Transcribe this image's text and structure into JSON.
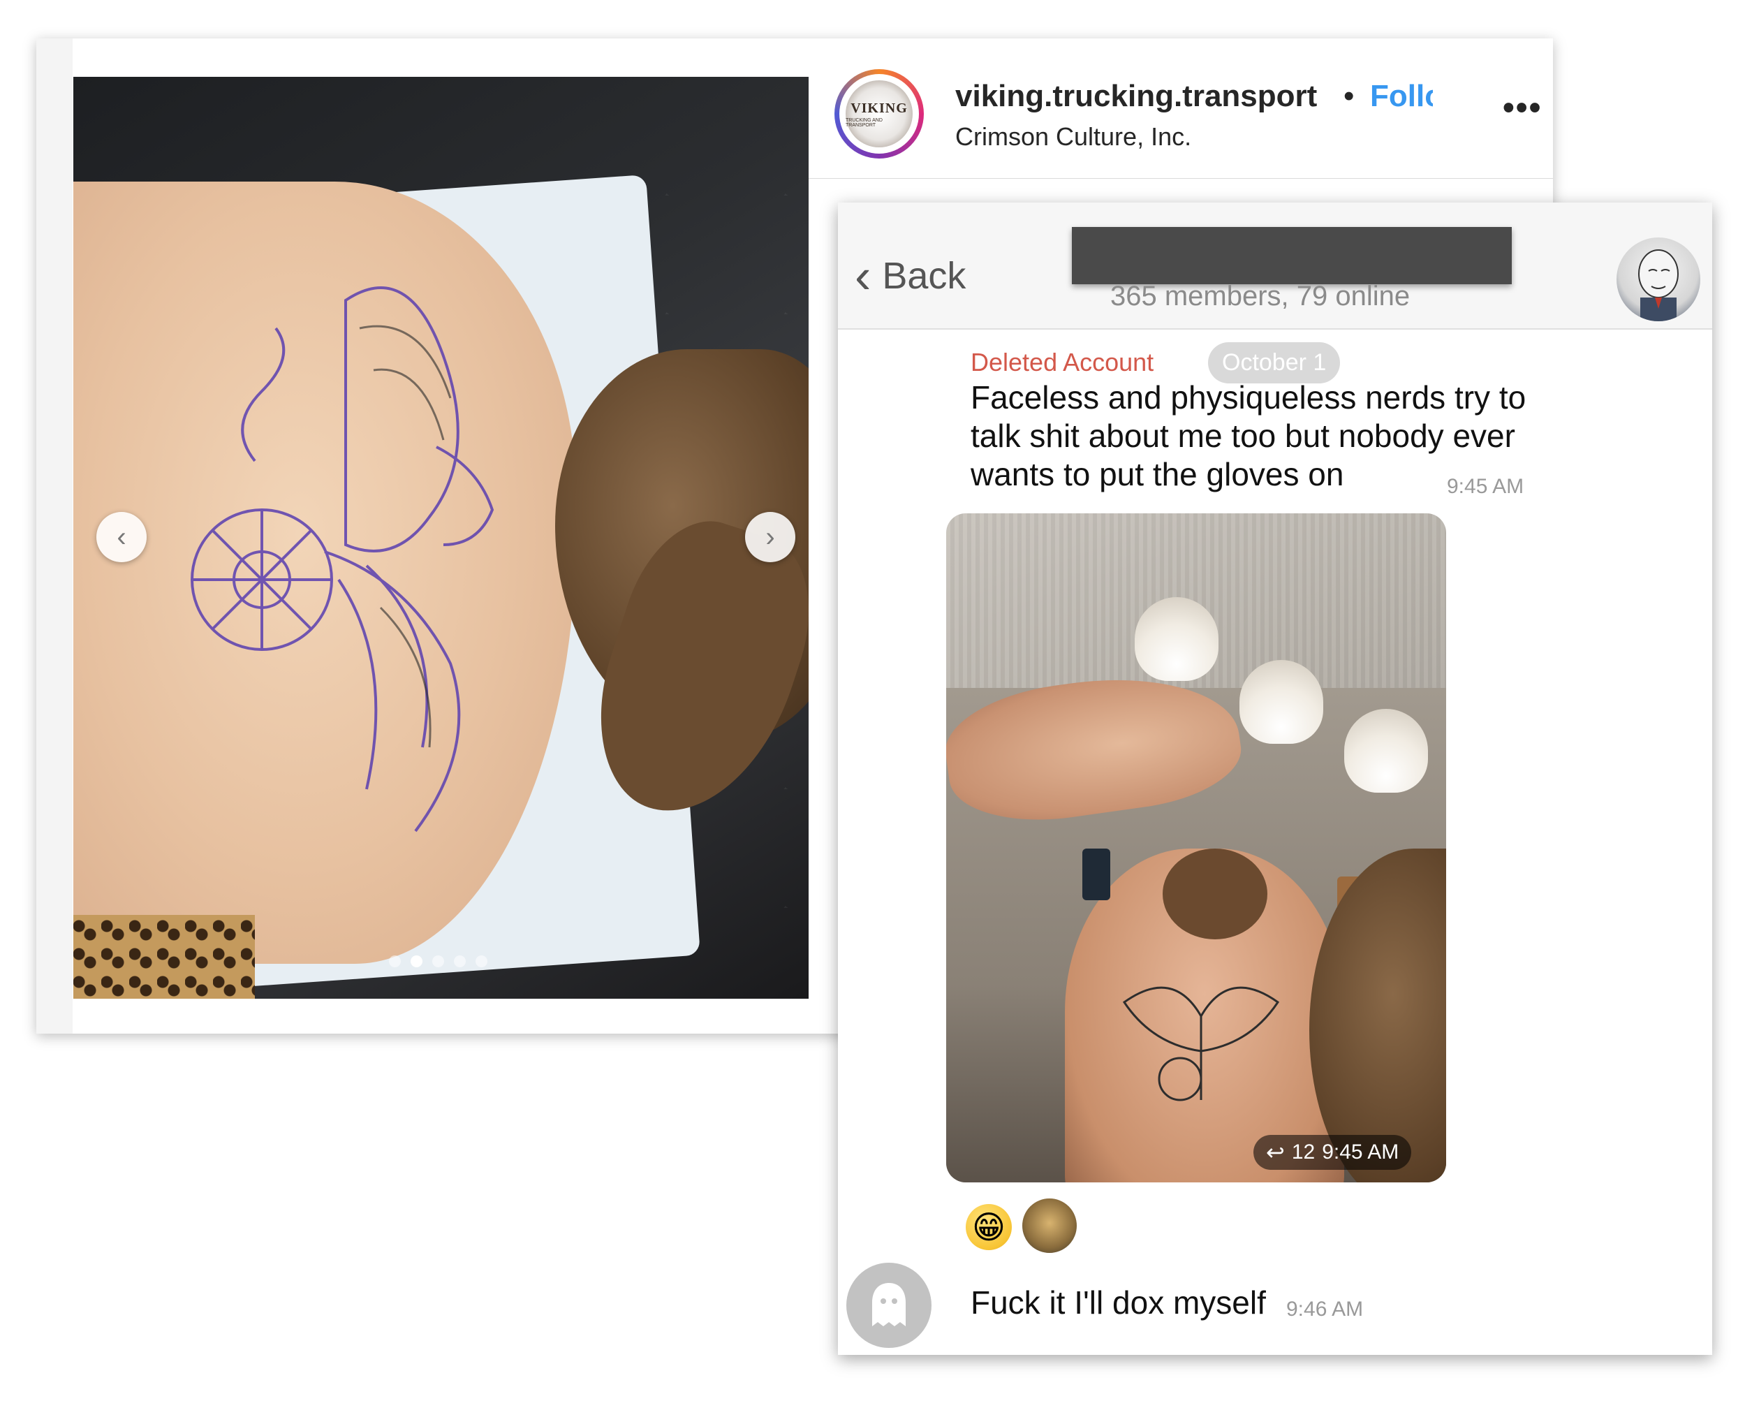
{
  "instagram": {
    "username": "viking.trucking.transport",
    "separator": "•",
    "follow_label": "Follow",
    "subtitle": "Crimson Culture, Inc.",
    "more_label": "•••",
    "logo_text": "VIKING",
    "logo_subtext": "TRUCKING AND TRANSPORT",
    "carousel": {
      "prev_icon": "chevron-left-icon",
      "next_icon": "chevron-right-icon",
      "total_slides": 5,
      "active_slide": 2
    },
    "colors": {
      "follow": "#3797f0",
      "text": "#262626"
    }
  },
  "telegram": {
    "back_label": "Back",
    "members_status": "365 members, 79 online",
    "messages": [
      {
        "sender": "Deleted Account",
        "date_pill": "October 1",
        "text": "Faceless and physiqueless nerds try to talk shit about me too but nobody ever wants to put the gloves on",
        "time": "9:45 AM"
      },
      {
        "media": true,
        "reply_count": "12",
        "time": "9:45 AM",
        "reactions": [
          "grinning-face-emoji",
          "user-avatar"
        ]
      },
      {
        "text": "Fuck it I'll dox myself",
        "time": "9:46 AM"
      }
    ],
    "colors": {
      "sender": "#d3584a",
      "time": "#999999",
      "pill": "#d9d9d9"
    }
  }
}
